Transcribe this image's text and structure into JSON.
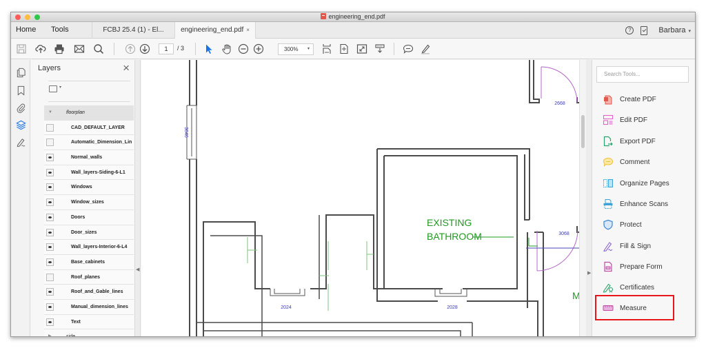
{
  "window": {
    "title": "engineering_end.pdf"
  },
  "tabbar": {
    "home_label": "Home",
    "tools_label": "Tools",
    "doc_tabs": [
      {
        "label": "FCBJ 25.4 (1) - El...",
        "active": false
      },
      {
        "label": "engineering_end.pdf",
        "active": true,
        "close": "×"
      }
    ],
    "help_glyph": "?",
    "user_name": "Barbara",
    "user_caret": "▾"
  },
  "toolbar": {
    "current_page": "1",
    "total_pages": "/ 3",
    "zoom_level": "300%",
    "zoom_caret": "▾",
    "icons": [
      "save-icon",
      "cloud-upload-icon",
      "print-icon",
      "email-icon",
      "search-icon",
      "page-up-icon",
      "page-down-icon",
      "select-arrow-icon",
      "hand-icon",
      "zoom-out-icon",
      "zoom-in-icon",
      "fit-width-icon",
      "fit-page-icon",
      "full-screen-icon",
      "read-mode-icon",
      "comment-icon",
      "highlight-pen-icon"
    ]
  },
  "left_rail": {
    "icons": [
      "page-thumbnails-icon",
      "bookmark-icon",
      "attachment-icon",
      "layers-icon",
      "signature-icon"
    ]
  },
  "layers_panel": {
    "title": "Layers",
    "close_glyph": "×",
    "options_caret": "▾",
    "group_name": "floorplan",
    "group_collapsed_name": "side",
    "layers": [
      {
        "name": "CAD_DEFAULT_LAYER",
        "visible": false
      },
      {
        "name": "Automatic_Dimension_Lin",
        "visible": false
      },
      {
        "name": "Normal_walls",
        "visible": true
      },
      {
        "name": "Wall_layers-Siding-6-L1",
        "visible": true
      },
      {
        "name": "Windows",
        "visible": true
      },
      {
        "name": "Window_sizes",
        "visible": true
      },
      {
        "name": "Doors",
        "visible": true
      },
      {
        "name": "Door_sizes",
        "visible": true
      },
      {
        "name": "Wall_layers-Interior-6-L4",
        "visible": true
      },
      {
        "name": "Base_cabinets",
        "visible": true
      },
      {
        "name": "Roof_planes",
        "visible": false
      },
      {
        "name": "Roof_and_Gable_lines",
        "visible": true
      },
      {
        "name": "Manual_dimension_lines",
        "visible": true
      },
      {
        "name": "Text",
        "visible": true
      }
    ]
  },
  "document": {
    "room_label_line1": "EXISTING",
    "room_label_line2": "BATHROOM",
    "room_label_partial": "MAS",
    "dimensions": {
      "window_left": "3646",
      "door_top": "2668",
      "window_bottom_left": "2024",
      "window_bottom_mid": "2028",
      "door_right": "3068"
    },
    "colors": {
      "wall": "#4a4a4a",
      "dimension_text": "#3b3bbb",
      "door_swing": "#b565c9",
      "annotation_green": "#1f9a1f",
      "light_green": "#7cc57c"
    }
  },
  "tools_pane": {
    "search_placeholder": "Search Tools...",
    "items": [
      {
        "label": "Create PDF",
        "icon": "create-pdf-icon",
        "color": "#e2574c"
      },
      {
        "label": "Edit PDF",
        "icon": "edit-pdf-icon",
        "color": "#e85fd0"
      },
      {
        "label": "Export PDF",
        "icon": "export-pdf-icon",
        "color": "#27a36b"
      },
      {
        "label": "Comment",
        "icon": "comment-icon",
        "color": "#f2c13b"
      },
      {
        "label": "Organize Pages",
        "icon": "organize-pages-icon",
        "color": "#3aa4d9"
      },
      {
        "label": "Enhance Scans",
        "icon": "enhance-scans-icon",
        "color": "#3aa4d9"
      },
      {
        "label": "Protect",
        "icon": "protect-icon",
        "color": "#3a86d9"
      },
      {
        "label": "Fill & Sign",
        "icon": "fill-sign-icon",
        "color": "#8a63d2"
      },
      {
        "label": "Prepare Form",
        "icon": "prepare-form-icon",
        "color": "#c14ba8"
      },
      {
        "label": "Certificates",
        "icon": "certificates-icon",
        "color": "#27a36b"
      },
      {
        "label": "Measure",
        "icon": "measure-icon",
        "color": "#c14ba8",
        "highlighted": true
      }
    ],
    "highlight_color": "#e8161a"
  }
}
